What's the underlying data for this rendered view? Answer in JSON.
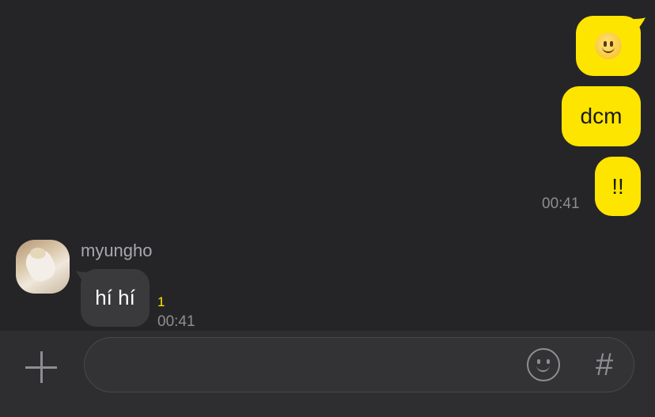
{
  "colors": {
    "background": "#252527",
    "outgoing_bubble": "#FEE500",
    "incoming_bubble": "#3a3a3c",
    "unread_accent": "#FEE500",
    "input_bar": "#2e2e30"
  },
  "messages": {
    "outgoing": [
      {
        "type": "emoji",
        "icon": "slightly-smiling-face-emoji"
      },
      {
        "type": "text",
        "text": "dcm"
      },
      {
        "type": "text",
        "text": "!!",
        "time": "00:41"
      }
    ],
    "incoming": [
      {
        "sender": "myungho",
        "text": "hí hí",
        "unread": "1",
        "time": "00:41"
      }
    ]
  },
  "input_bar": {
    "message_value": "",
    "plus_icon": "plus-icon",
    "emoji_icon": "smiley-icon",
    "hash_label": "#"
  }
}
